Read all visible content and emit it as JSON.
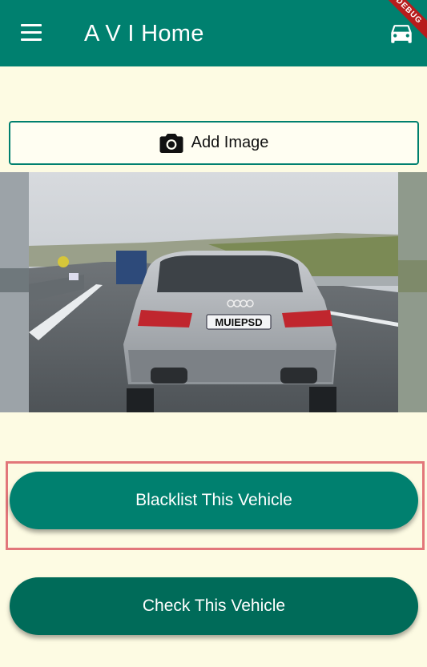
{
  "appbar": {
    "title": "A V I Home",
    "menu_icon": "menu-icon",
    "car_icon": "car-icon",
    "debug_banner": "DEBUG"
  },
  "add_image": {
    "label": "Add Image",
    "icon": "camera-icon"
  },
  "photo": {
    "plate": "MUIEPSD"
  },
  "actions": {
    "blacklist_label": "Blacklist This Vehicle",
    "check_label": "Check This Vehicle"
  },
  "colors": {
    "primary": "#00806F",
    "primary_dark": "#006B59",
    "background": "#FDFBE3",
    "highlight": "#E2777A"
  }
}
